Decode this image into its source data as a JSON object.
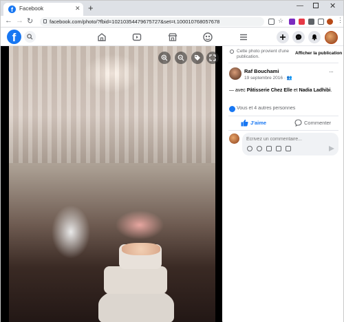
{
  "browser": {
    "tab_title": "Facebook",
    "tab_close": "✕",
    "new_tab": "+",
    "url": "facebook.com/photo/?fbid=10210354479675727&set=t.100010768057678",
    "window_controls": {
      "minimize": "—",
      "close": "✕"
    }
  },
  "fb_header": {
    "logo": "f",
    "nav_icons": [
      "home-icon",
      "watch-icon",
      "marketplace-icon",
      "groups-icon",
      "menu-icon"
    ],
    "action_icons": [
      "create-icon",
      "messenger-icon",
      "notifications-icon"
    ],
    "brand_color": "#1877f2"
  },
  "photo": {
    "controls": [
      "zoom-in-icon",
      "zoom-out-icon",
      "tag-icon",
      "fullscreen-icon"
    ]
  },
  "panel": {
    "notice": "Cette photo provient d'une publication.",
    "show_publication": "Afficher la publication",
    "author": "Raf Bouchami",
    "date": "19 septembre 2016 · ",
    "more": "···",
    "caption_prefix": "— avec ",
    "tag1": "Pâtisserie Chez Elle",
    "caption_and": " et ",
    "tag2": "Nadia Ladhibi",
    "caption_suffix": ".",
    "reactions": "Vous et 4 autres personnes",
    "like_label": "J'aime",
    "comment_label": "Commenter",
    "comment_placeholder": "Écrivez un commentaire..."
  }
}
